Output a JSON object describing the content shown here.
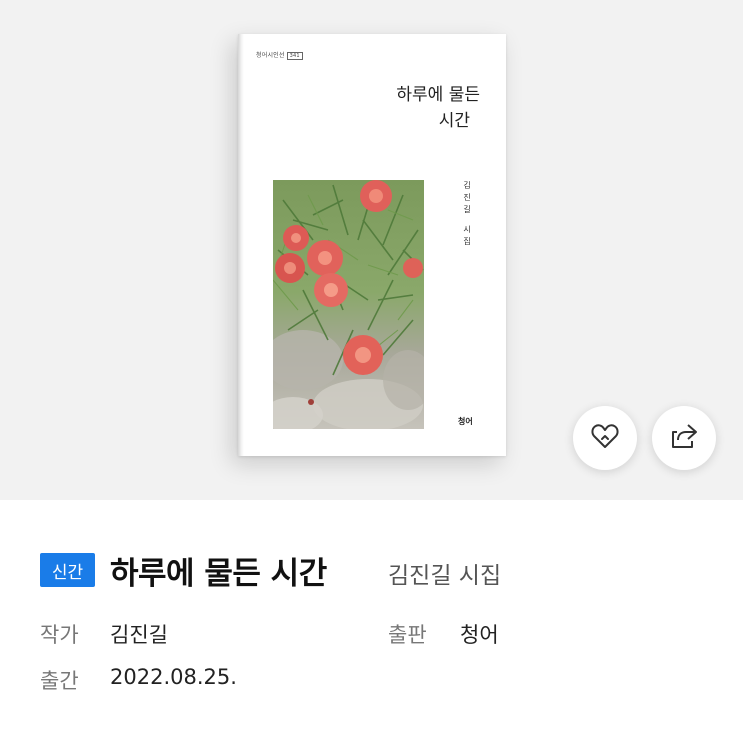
{
  "cover": {
    "series_label": "청어시인선",
    "series_number": "341",
    "title_line1": "하루에 물든",
    "title_line2": "시간",
    "author_name_chars": [
      "김",
      "진",
      "길"
    ],
    "author_suffix_chars": [
      "시",
      "집"
    ],
    "publisher_logo": "청어"
  },
  "actions": {
    "like_icon": "heart-icon",
    "share_icon": "share-icon"
  },
  "book": {
    "badge": "신간",
    "title": "하루에 물든 시간",
    "subtitle": "김진길 시집",
    "author_label": "작가",
    "author": "김진길",
    "publisher_label": "출판",
    "publisher": "청어",
    "date_label": "출간",
    "date": "2022.08.25."
  },
  "colors": {
    "badge_bg": "#1a7ce8",
    "cover_bg": "#f2f2f2"
  }
}
